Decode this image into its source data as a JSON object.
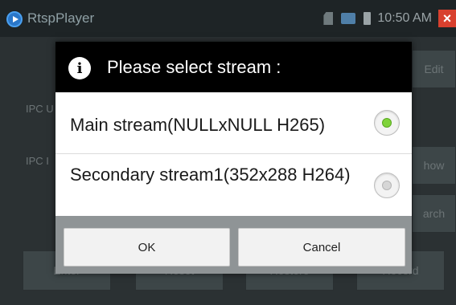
{
  "app": {
    "title": "RtspPlayer",
    "time": "10:50 AM",
    "icons": [
      "app-icon",
      "sd-card-icon",
      "network-icon",
      "battery-icon",
      "close-icon"
    ],
    "close_symbol": "×"
  },
  "background": {
    "edit_label": "Edit",
    "show_label": "how",
    "search_label": "arch",
    "ipc_label_1": "IPC U",
    "ipc_label_2": "IPC I",
    "bottom_buttons": [
      "Enter",
      "Reset",
      "Restore",
      "Record"
    ]
  },
  "dialog": {
    "title": "Please select stream :",
    "info_symbol": "i",
    "options": [
      {
        "label": "Main stream(NULLxNULL H265)",
        "selected": true
      },
      {
        "label": "Secondary stream1(352x288 H264)",
        "selected": false
      }
    ],
    "ok_label": "OK",
    "cancel_label": "Cancel"
  },
  "colors": {
    "radio_selected": "#7fd33a",
    "header_bg": "#000000",
    "close_bg": "#d8402e"
  }
}
